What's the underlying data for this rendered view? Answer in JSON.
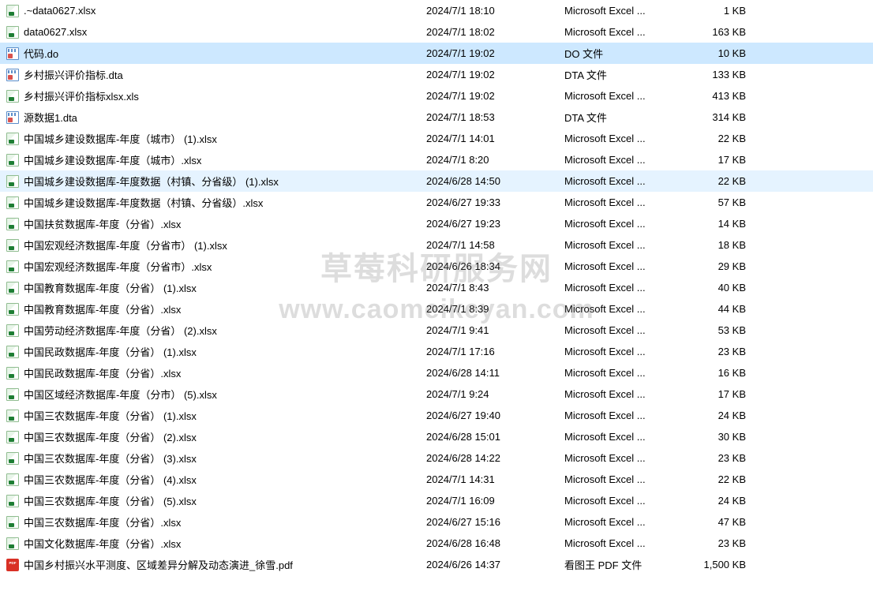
{
  "watermark": {
    "line1": "草莓科研服务网",
    "line2": "www.caomeikeyan.com"
  },
  "files": [
    {
      "name": ".~data0627.xlsx",
      "date": "2024/7/1 18:10",
      "type": "Microsoft Excel ...",
      "size": "1 KB",
      "icon": "xlsx",
      "state": ""
    },
    {
      "name": "data0627.xlsx",
      "date": "2024/7/1 18:02",
      "type": "Microsoft Excel ...",
      "size": "163 KB",
      "icon": "xlsx",
      "state": ""
    },
    {
      "name": "代码.do",
      "date": "2024/7/1 19:02",
      "type": "DO 文件",
      "size": "10 KB",
      "icon": "do",
      "state": "selected"
    },
    {
      "name": "乡村振兴评价指标.dta",
      "date": "2024/7/1 19:02",
      "type": "DTA 文件",
      "size": "133 KB",
      "icon": "dta",
      "state": ""
    },
    {
      "name": "乡村振兴评价指标xlsx.xls",
      "date": "2024/7/1 19:02",
      "type": "Microsoft Excel ...",
      "size": "413 KB",
      "icon": "xlsx",
      "state": ""
    },
    {
      "name": "源数据1.dta",
      "date": "2024/7/1 18:53",
      "type": "DTA 文件",
      "size": "314 KB",
      "icon": "dta",
      "state": ""
    },
    {
      "name": "中国城乡建设数据库-年度（城市） (1).xlsx",
      "date": "2024/7/1 14:01",
      "type": "Microsoft Excel ...",
      "size": "22 KB",
      "icon": "xlsx",
      "state": ""
    },
    {
      "name": "中国城乡建设数据库-年度（城市）.xlsx",
      "date": "2024/7/1 8:20",
      "type": "Microsoft Excel ...",
      "size": "17 KB",
      "icon": "xlsx",
      "state": ""
    },
    {
      "name": "中国城乡建设数据库-年度数据（村镇、分省级） (1).xlsx",
      "date": "2024/6/28 14:50",
      "type": "Microsoft Excel ...",
      "size": "22 KB",
      "icon": "xlsx",
      "state": "hover"
    },
    {
      "name": "中国城乡建设数据库-年度数据（村镇、分省级）.xlsx",
      "date": "2024/6/27 19:33",
      "type": "Microsoft Excel ...",
      "size": "57 KB",
      "icon": "xlsx",
      "state": ""
    },
    {
      "name": "中国扶贫数据库-年度（分省）.xlsx",
      "date": "2024/6/27 19:23",
      "type": "Microsoft Excel ...",
      "size": "14 KB",
      "icon": "xlsx",
      "state": ""
    },
    {
      "name": "中国宏观经济数据库-年度（分省市） (1).xlsx",
      "date": "2024/7/1 14:58",
      "type": "Microsoft Excel ...",
      "size": "18 KB",
      "icon": "xlsx",
      "state": ""
    },
    {
      "name": "中国宏观经济数据库-年度（分省市）.xlsx",
      "date": "2024/6/26 18:34",
      "type": "Microsoft Excel ...",
      "size": "29 KB",
      "icon": "xlsx",
      "state": ""
    },
    {
      "name": "中国教育数据库-年度（分省） (1).xlsx",
      "date": "2024/7/1 8:43",
      "type": "Microsoft Excel ...",
      "size": "40 KB",
      "icon": "xlsx",
      "state": ""
    },
    {
      "name": "中国教育数据库-年度（分省）.xlsx",
      "date": "2024/7/1 8:39",
      "type": "Microsoft Excel ...",
      "size": "44 KB",
      "icon": "xlsx",
      "state": ""
    },
    {
      "name": "中国劳动经济数据库-年度（分省） (2).xlsx",
      "date": "2024/7/1 9:41",
      "type": "Microsoft Excel ...",
      "size": "53 KB",
      "icon": "xlsx",
      "state": ""
    },
    {
      "name": "中国民政数据库-年度（分省） (1).xlsx",
      "date": "2024/7/1 17:16",
      "type": "Microsoft Excel ...",
      "size": "23 KB",
      "icon": "xlsx",
      "state": ""
    },
    {
      "name": "中国民政数据库-年度（分省）.xlsx",
      "date": "2024/6/28 14:11",
      "type": "Microsoft Excel ...",
      "size": "16 KB",
      "icon": "xlsx",
      "state": ""
    },
    {
      "name": "中国区域经济数据库-年度（分市） (5).xlsx",
      "date": "2024/7/1 9:24",
      "type": "Microsoft Excel ...",
      "size": "17 KB",
      "icon": "xlsx",
      "state": ""
    },
    {
      "name": "中国三农数据库-年度（分省） (1).xlsx",
      "date": "2024/6/27 19:40",
      "type": "Microsoft Excel ...",
      "size": "24 KB",
      "icon": "xlsx",
      "state": ""
    },
    {
      "name": "中国三农数据库-年度（分省） (2).xlsx",
      "date": "2024/6/28 15:01",
      "type": "Microsoft Excel ...",
      "size": "30 KB",
      "icon": "xlsx",
      "state": ""
    },
    {
      "name": "中国三农数据库-年度（分省） (3).xlsx",
      "date": "2024/6/28 14:22",
      "type": "Microsoft Excel ...",
      "size": "23 KB",
      "icon": "xlsx",
      "state": ""
    },
    {
      "name": "中国三农数据库-年度（分省） (4).xlsx",
      "date": "2024/7/1 14:31",
      "type": "Microsoft Excel ...",
      "size": "22 KB",
      "icon": "xlsx",
      "state": ""
    },
    {
      "name": "中国三农数据库-年度（分省） (5).xlsx",
      "date": "2024/7/1 16:09",
      "type": "Microsoft Excel ...",
      "size": "24 KB",
      "icon": "xlsx",
      "state": ""
    },
    {
      "name": "中国三农数据库-年度（分省）.xlsx",
      "date": "2024/6/27 15:16",
      "type": "Microsoft Excel ...",
      "size": "47 KB",
      "icon": "xlsx",
      "state": ""
    },
    {
      "name": "中国文化数据库-年度（分省）.xlsx",
      "date": "2024/6/28 16:48",
      "type": "Microsoft Excel ...",
      "size": "23 KB",
      "icon": "xlsx",
      "state": ""
    },
    {
      "name": "中国乡村振兴水平测度、区域差异分解及动态演进_徐雪.pdf",
      "date": "2024/6/26 14:37",
      "type": "看图王 PDF 文件",
      "size": "1,500 KB",
      "icon": "pdf",
      "state": ""
    }
  ]
}
